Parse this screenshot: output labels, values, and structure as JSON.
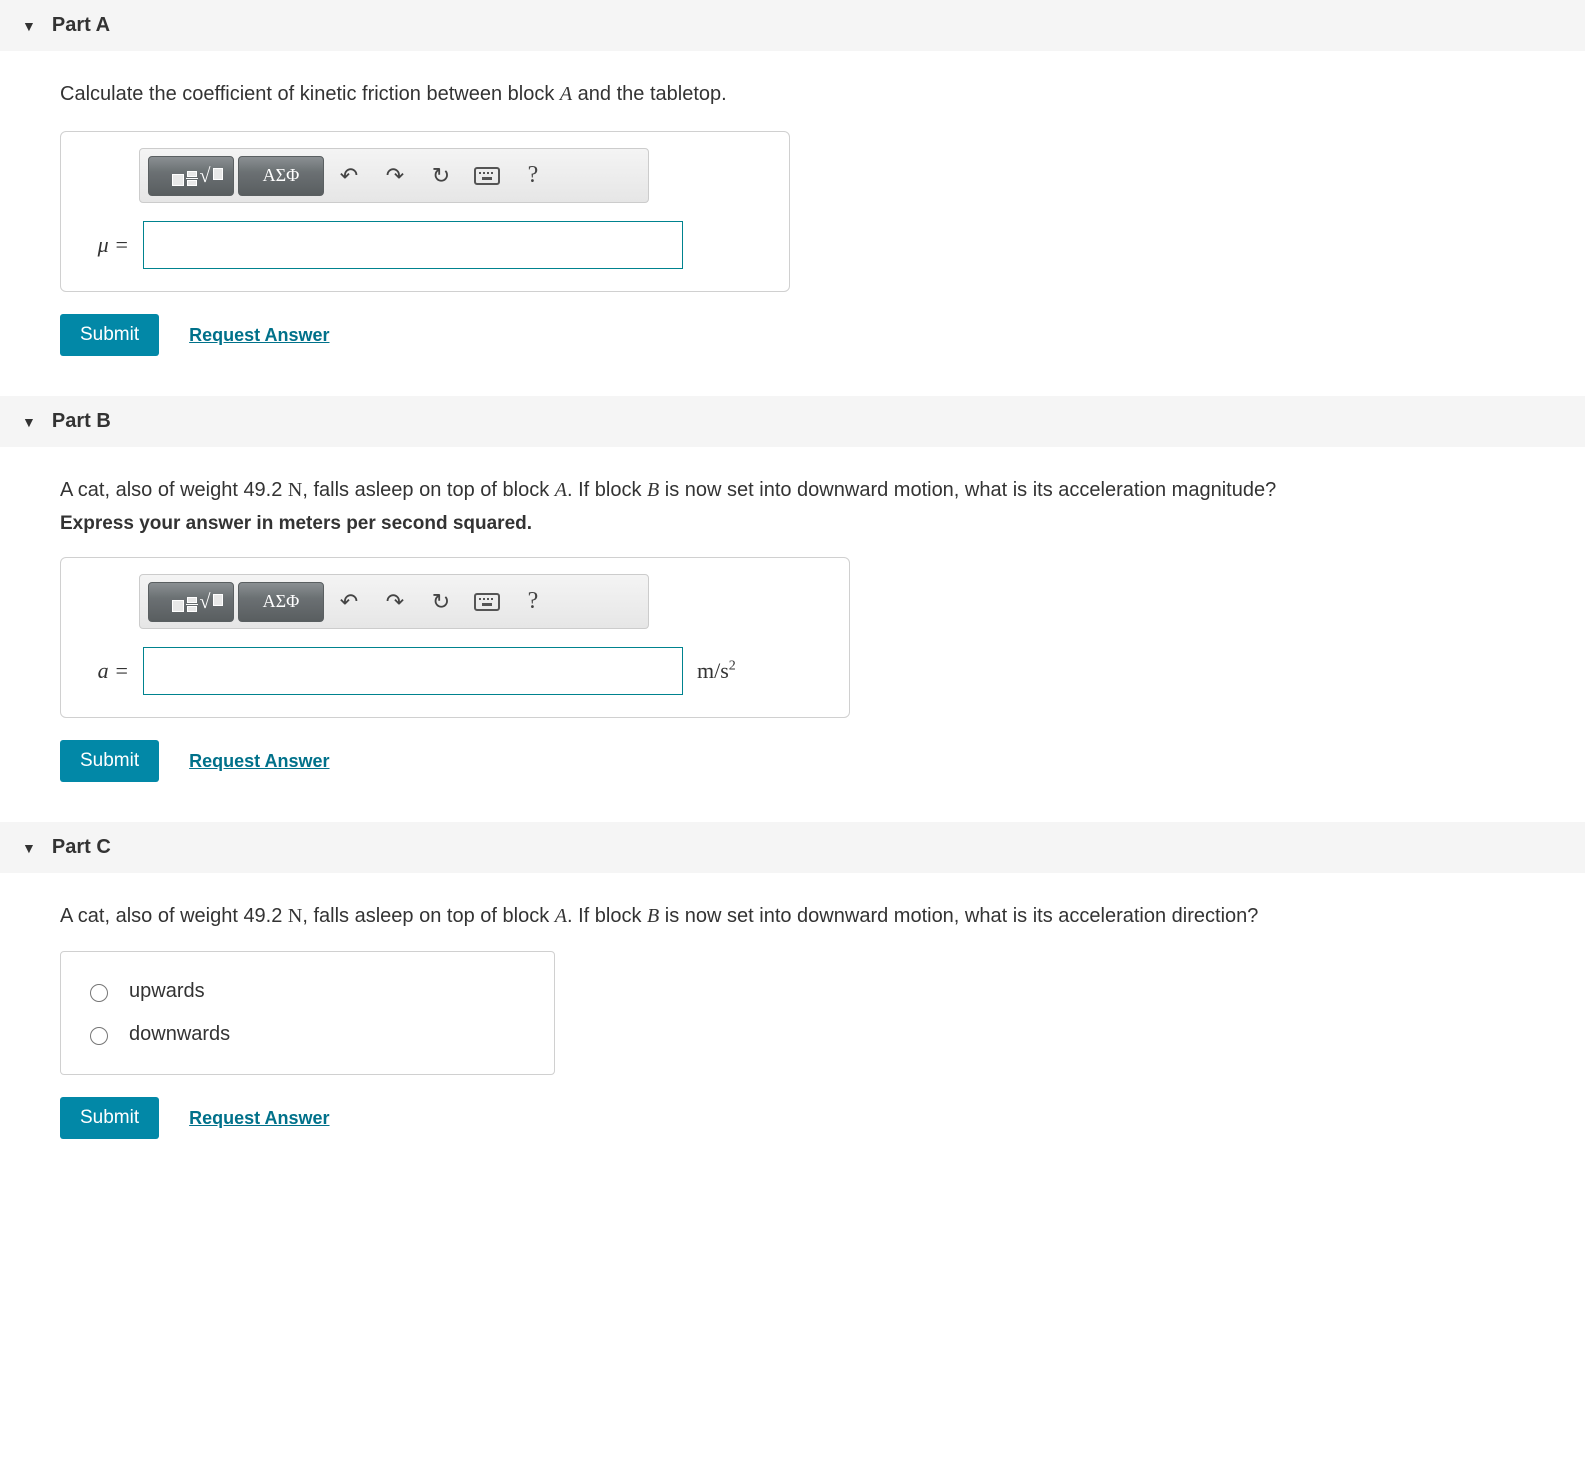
{
  "parts": {
    "a": {
      "title": "Part A",
      "prompt_pre": "Calculate the coefficient of kinetic friction between block ",
      "prompt_var1": "A",
      "prompt_post": " and the tabletop.",
      "var_label": "μ =",
      "submit": "Submit",
      "request": "Request Answer"
    },
    "b": {
      "title": "Part B",
      "prompt_pre": "A cat, also of weight 49.2 ",
      "prompt_unit": "N",
      "prompt_mid1": ", falls asleep on top of block ",
      "prompt_var1": "A",
      "prompt_mid2": ". If block ",
      "prompt_var2": "B",
      "prompt_post": " is now set into downward motion, what is its acceleration magnitude?",
      "instruction": "Express your answer in meters per second squared.",
      "var_label": "a =",
      "units_pre": "m/s",
      "units_sup": "2",
      "submit": "Submit",
      "request": "Request Answer"
    },
    "c": {
      "title": "Part C",
      "prompt_pre": "A cat, also of weight 49.2 ",
      "prompt_unit": "N",
      "prompt_mid1": ", falls asleep on top of block ",
      "prompt_var1": "A",
      "prompt_mid2": ". If block ",
      "prompt_var2": "B",
      "prompt_post": " is now set into downward motion, what is its acceleration direction?",
      "options": {
        "o1": "upwards",
        "o2": "downwards"
      },
      "submit": "Submit",
      "request": "Request Answer"
    }
  },
  "toolbar": {
    "greek": "ΑΣΦ",
    "undo": "↶",
    "redo": "↷",
    "reset": "↻",
    "help": "?"
  }
}
